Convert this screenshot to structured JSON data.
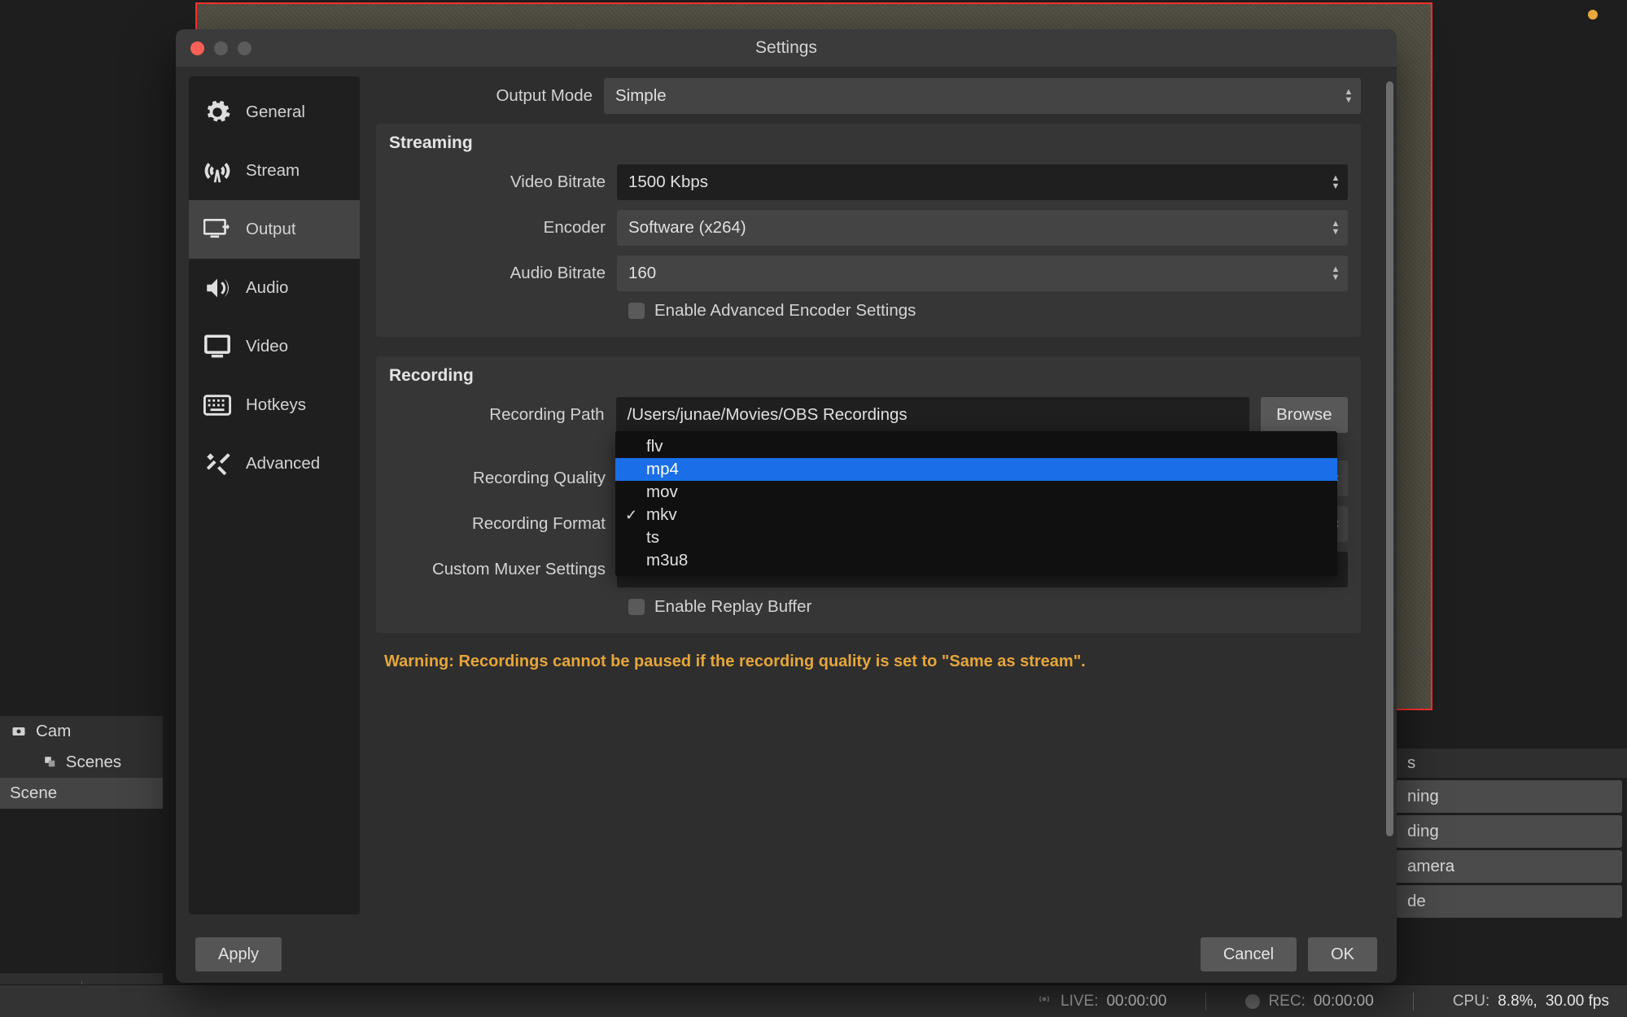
{
  "window_title": "Settings",
  "sidebar": {
    "items": [
      {
        "label": "General",
        "icon": "gear-icon"
      },
      {
        "label": "Stream",
        "icon": "antenna-icon"
      },
      {
        "label": "Output",
        "icon": "monitor-arrow-icon"
      },
      {
        "label": "Audio",
        "icon": "speaker-icon"
      },
      {
        "label": "Video",
        "icon": "monitor-icon"
      },
      {
        "label": "Hotkeys",
        "icon": "keyboard-icon"
      },
      {
        "label": "Advanced",
        "icon": "tools-icon"
      }
    ]
  },
  "output_mode": {
    "label": "Output Mode",
    "value": "Simple"
  },
  "streaming": {
    "title": "Streaming",
    "video_bitrate": {
      "label": "Video Bitrate",
      "value": "1500 Kbps"
    },
    "encoder": {
      "label": "Encoder",
      "value": "Software (x264)"
    },
    "audio_bitrate": {
      "label": "Audio Bitrate",
      "value": "160"
    },
    "advanced_encoder_cb": "Enable Advanced Encoder Settings"
  },
  "recording": {
    "title": "Recording",
    "path": {
      "label": "Recording Path",
      "value": "/Users/junae/Movies/OBS Recordings"
    },
    "browse": "Browse",
    "quality": {
      "label": "Recording Quality"
    },
    "format": {
      "label": "Recording Format",
      "current": "mkv",
      "options": [
        "flv",
        "mp4",
        "mov",
        "mkv",
        "ts",
        "m3u8"
      ],
      "highlighted": "mp4"
    },
    "muxer": {
      "label": "Custom Muxer Settings"
    },
    "replay_cb": "Enable Replay Buffer"
  },
  "warning": "Warning: Recordings cannot be paused if the recording quality is set to \"Same as stream\".",
  "buttons": {
    "apply": "Apply",
    "cancel": "Cancel",
    "ok": "OK"
  },
  "dock": {
    "cam": "Cam",
    "scenes_header": "Scenes",
    "scene_row": "Scene"
  },
  "right_panel": {
    "header": "s",
    "buttons": [
      "ning",
      "ding",
      "amera",
      "de"
    ]
  },
  "statusbar": {
    "live_label": "LIVE:",
    "live_time": "00:00:00",
    "rec_label": "REC:",
    "rec_time": "00:00:00",
    "cpu_label": "CPU:",
    "cpu_value": "8.8%,",
    "fps": "30.00 fps"
  }
}
